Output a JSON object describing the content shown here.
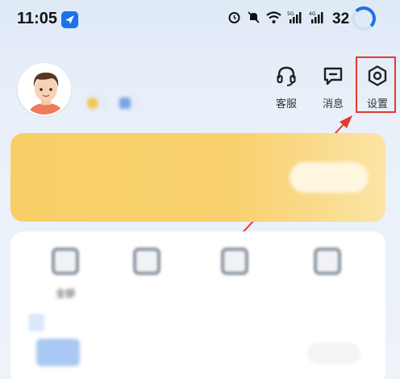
{
  "status_bar": {
    "time": "11:05",
    "battery": "32",
    "icons": [
      "alarm-icon",
      "mute-icon",
      "wifi-icon",
      "signal-5g-icon",
      "signal-4g-icon"
    ]
  },
  "profile": {
    "name": "",
    "badge_1": "",
    "badge_2": ""
  },
  "actions": {
    "service_label": "客服",
    "message_label": "消息",
    "settings_label": "设置"
  },
  "vip": {
    "title": "",
    "subtitle": "",
    "button_label": ""
  },
  "tools": [
    {
      "label": "全部"
    },
    {
      "label": ""
    },
    {
      "label": ""
    },
    {
      "label": ""
    }
  ],
  "recent": {
    "tag": "",
    "title": "",
    "subtitle": "",
    "button_label": ""
  },
  "colors": {
    "accent": "#1a73e8",
    "vip_gold": "#f7cf66",
    "highlight_red": "#e23a2e"
  }
}
